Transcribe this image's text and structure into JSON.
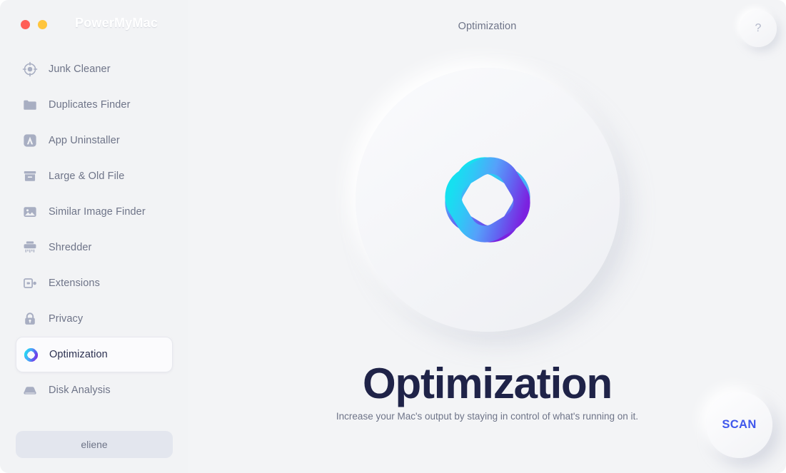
{
  "window": {
    "brand": "PowerMyMac",
    "traffic_lights": [
      "close",
      "minimize"
    ],
    "colors": {
      "close": "#ff5f57",
      "minimize": "#ffc53d",
      "background": "#f3f4f6",
      "sidebar": "#f2f3f5",
      "accent": "#3f57ec",
      "headline": "#1f2348",
      "muted_text": "#6e7488"
    }
  },
  "sidebar": {
    "items": [
      {
        "label": "Junk Cleaner",
        "icon": "target-icon",
        "selected": false
      },
      {
        "label": "Duplicates Finder",
        "icon": "folder-icon",
        "selected": false
      },
      {
        "label": "App Uninstaller",
        "icon": "app-store-icon",
        "selected": false
      },
      {
        "label": "Large & Old File",
        "icon": "archive-box-icon",
        "selected": false
      },
      {
        "label": "Similar Image Finder",
        "icon": "image-icon",
        "selected": false
      },
      {
        "label": "Shredder",
        "icon": "shredder-icon",
        "selected": false
      },
      {
        "label": "Extensions",
        "icon": "extension-plug-icon",
        "selected": false
      },
      {
        "label": "Privacy",
        "icon": "lock-icon",
        "selected": false
      },
      {
        "label": "Optimization",
        "icon": "optimization-knot-icon",
        "selected": true
      },
      {
        "label": "Disk Analysis",
        "icon": "hard-drive-icon",
        "selected": false
      }
    ],
    "user_button": "eliene"
  },
  "main": {
    "title": "Optimization",
    "help_label": "?",
    "hero_icon": "optimization-knot-icon",
    "headline": "Optimization",
    "subhead": "Increase your Mac's output by staying in control of what's running on it.",
    "scan_label": "SCAN"
  }
}
